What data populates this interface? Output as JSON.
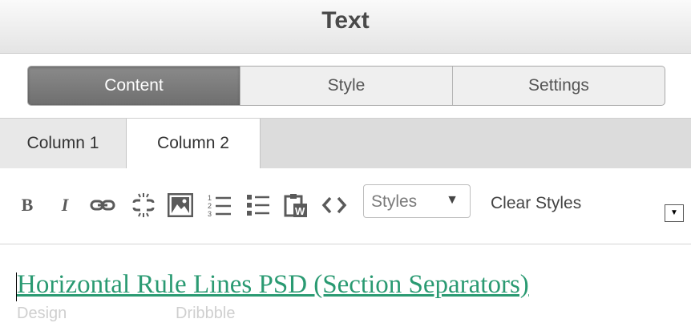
{
  "window": {
    "title": "Text"
  },
  "segments": [
    {
      "label": "Content",
      "active": true
    },
    {
      "label": "Style",
      "active": false
    },
    {
      "label": "Settings",
      "active": false
    }
  ],
  "column_tabs": [
    {
      "label": "Column 1",
      "active": false
    },
    {
      "label": "Column 2",
      "active": true
    }
  ],
  "toolbar": {
    "bold_label": "B",
    "italic_label": "I",
    "styles_select": {
      "value": "Styles",
      "arrow": "▼"
    },
    "clear_styles_label": "Clear Styles",
    "expand_label": "▼",
    "icons": [
      "bold-icon",
      "italic-icon",
      "link-icon",
      "unlink-icon",
      "image-icon",
      "numbered-list-icon",
      "bulleted-list-icon",
      "paste-from-word-icon",
      "source-code-icon"
    ]
  },
  "editor": {
    "link_text": "Horizontal Rule Lines PSD (Section Separators)",
    "meta": [
      "Design",
      "Dribbble"
    ],
    "link_color": "#2a9a72"
  }
}
